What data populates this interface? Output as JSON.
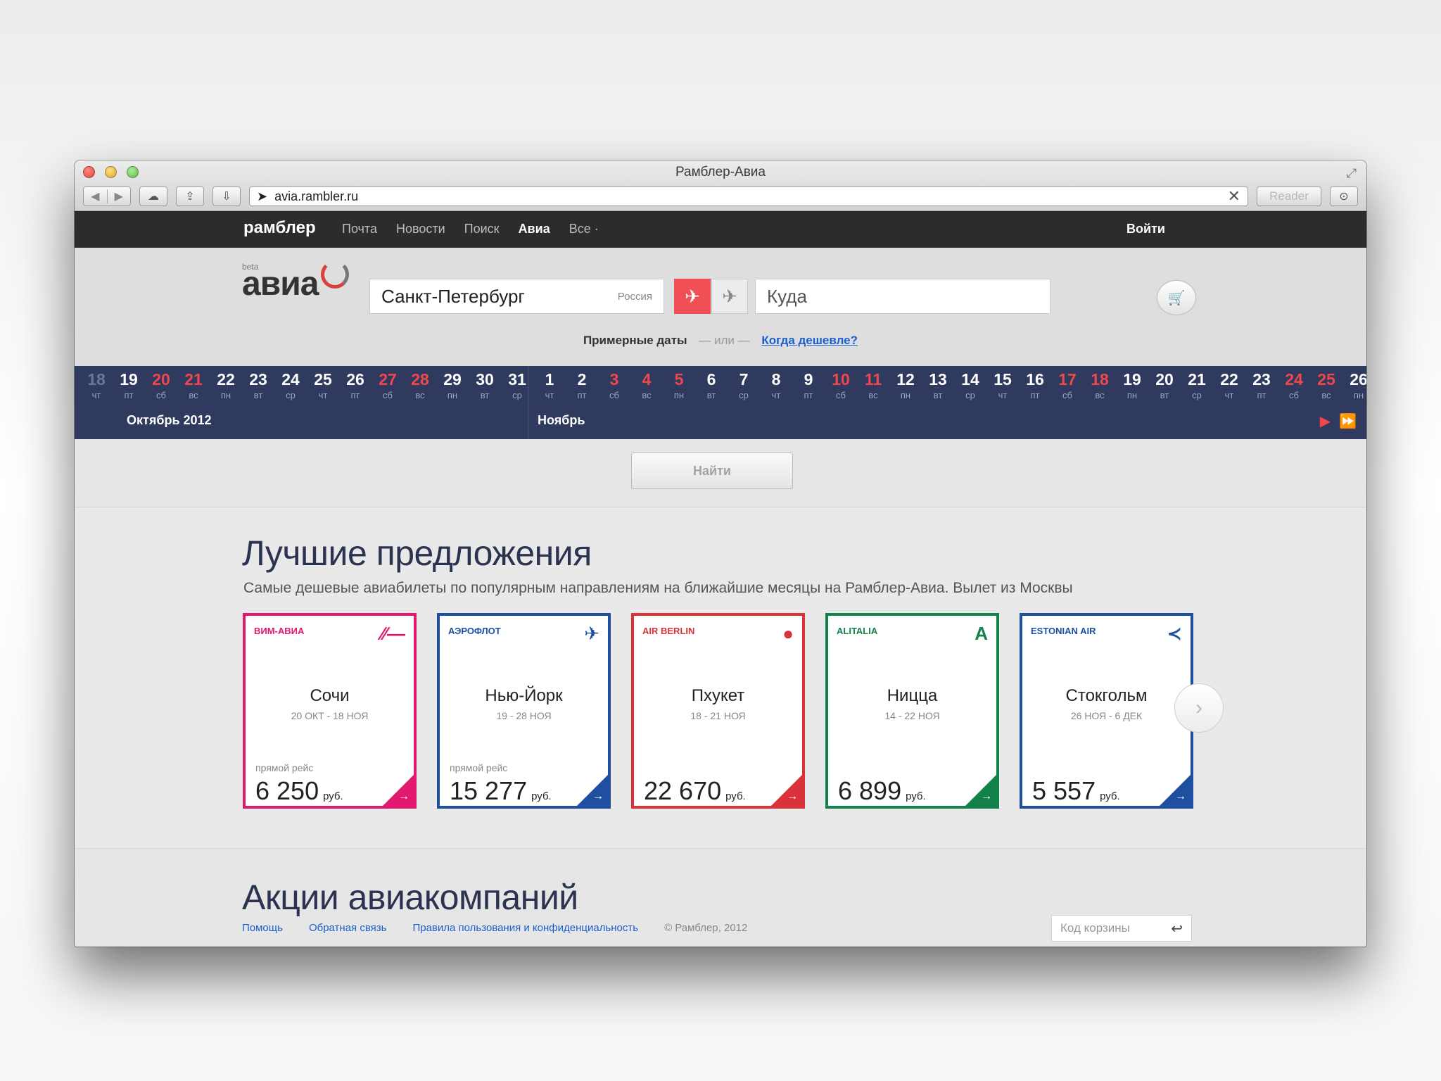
{
  "browser": {
    "title": "Рамблер-Авиа",
    "url": "avia.rambler.ru",
    "reader_label": "Reader"
  },
  "topnav": {
    "brand": "рамблер",
    "links": [
      {
        "label": "Почта",
        "active": false
      },
      {
        "label": "Новости",
        "active": false
      },
      {
        "label": "Поиск",
        "active": false
      },
      {
        "label": "Авиа",
        "active": true
      },
      {
        "label": "Все ·",
        "active": false
      }
    ],
    "login": "Войти"
  },
  "search": {
    "logo_beta": "beta",
    "logo_word": "авиа",
    "from_city": "Санкт-Петербург",
    "from_country": "Россия",
    "to_placeholder": "Куда",
    "approx_dates": "Примерные даты",
    "or": "или",
    "cheaper_link": "Когда дешевле?"
  },
  "calendar": {
    "months": [
      {
        "label": "Октябрь 2012"
      },
      {
        "label": "Ноябрь"
      }
    ],
    "days": [
      {
        "n": "18",
        "w": "чт",
        "past": true
      },
      {
        "n": "19",
        "w": "пт"
      },
      {
        "n": "20",
        "w": "сб",
        "weekend": true
      },
      {
        "n": "21",
        "w": "вс",
        "weekend": true
      },
      {
        "n": "22",
        "w": "пн"
      },
      {
        "n": "23",
        "w": "вт"
      },
      {
        "n": "24",
        "w": "ср"
      },
      {
        "n": "25",
        "w": "чт"
      },
      {
        "n": "26",
        "w": "пт"
      },
      {
        "n": "27",
        "w": "сб",
        "weekend": true
      },
      {
        "n": "28",
        "w": "вс",
        "weekend": true
      },
      {
        "n": "29",
        "w": "пн"
      },
      {
        "n": "30",
        "w": "вт"
      },
      {
        "n": "31",
        "w": "ср"
      },
      {
        "n": "1",
        "w": "чт"
      },
      {
        "n": "2",
        "w": "пт"
      },
      {
        "n": "3",
        "w": "сб",
        "weekend": true
      },
      {
        "n": "4",
        "w": "вс",
        "weekend": true
      },
      {
        "n": "5",
        "w": "пн",
        "weekend": true
      },
      {
        "n": "6",
        "w": "вт"
      },
      {
        "n": "7",
        "w": "ср"
      },
      {
        "n": "8",
        "w": "чт"
      },
      {
        "n": "9",
        "w": "пт"
      },
      {
        "n": "10",
        "w": "сб",
        "weekend": true
      },
      {
        "n": "11",
        "w": "вс",
        "weekend": true
      },
      {
        "n": "12",
        "w": "пн"
      },
      {
        "n": "13",
        "w": "вт"
      },
      {
        "n": "14",
        "w": "ср"
      },
      {
        "n": "15",
        "w": "чт"
      },
      {
        "n": "16",
        "w": "пт"
      },
      {
        "n": "17",
        "w": "сб",
        "weekend": true
      },
      {
        "n": "18",
        "w": "вс",
        "weekend": true
      },
      {
        "n": "19",
        "w": "пн"
      },
      {
        "n": "20",
        "w": "вт"
      },
      {
        "n": "21",
        "w": "ср"
      },
      {
        "n": "22",
        "w": "чт"
      },
      {
        "n": "23",
        "w": "пт"
      },
      {
        "n": "24",
        "w": "сб",
        "weekend": true
      },
      {
        "n": "25",
        "w": "вс",
        "weekend": true
      },
      {
        "n": "26",
        "w": "пн"
      }
    ]
  },
  "find_button": "Найти",
  "offers": {
    "title": "Лучшие предложения",
    "subtitle": "Самые дешевые авиабилеты по популярным направлениям на ближайшие месяцы на Рамблер-Авиа. Вылет из Москвы",
    "cards": [
      {
        "airline": "ВИМ-АВИА",
        "city": "Сочи",
        "dates": "20 ОКТ - 18 НОЯ",
        "direct": "прямой рейс",
        "price": "6 250",
        "currency": "руб.",
        "color": "#e0196f",
        "icon": "∕∕—"
      },
      {
        "airline": "АЭРОФЛОТ",
        "city": "Нью-Йорк",
        "dates": "19 - 28 НОЯ",
        "direct": "прямой рейс",
        "price": "15 277",
        "currency": "руб.",
        "color": "#1f4fa0",
        "icon": "✈"
      },
      {
        "airline": "AIR BERLIN",
        "city": "Пхукет",
        "dates": "18 - 21 НОЯ",
        "direct": "",
        "price": "22 670",
        "currency": "руб.",
        "color": "#d9323a",
        "icon": "●"
      },
      {
        "airline": "ALITALIA",
        "city": "Ницца",
        "dates": "14 - 22 НОЯ",
        "direct": "",
        "price": "6 899",
        "currency": "руб.",
        "color": "#13824a",
        "icon": "A"
      },
      {
        "airline": "ESTONIAN AIR",
        "city": "Стокгольм",
        "dates": "26 НОЯ - 6 ДЕК",
        "direct": "",
        "price": "5 557",
        "currency": "руб.",
        "color": "#1f4fa0",
        "icon": "≺"
      }
    ]
  },
  "promo": {
    "title": "Акции авиакомпаний"
  },
  "footer": {
    "links": [
      "Помощь",
      "Обратная связь",
      "Правила пользования и конфиденциальность"
    ],
    "copyright": "© Рамблер, 2012",
    "basket_placeholder": "Код корзины"
  }
}
